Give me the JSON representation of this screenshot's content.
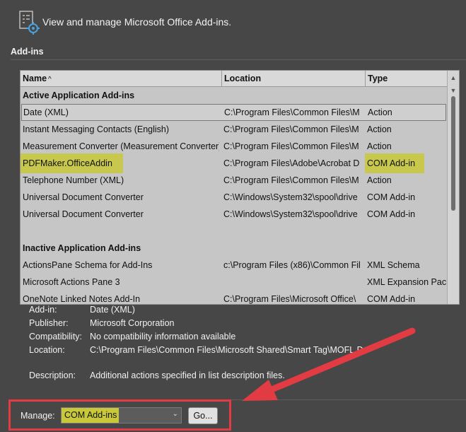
{
  "header": {
    "title": "View and manage Microsoft Office Add-ins.",
    "icon": "addins-gear-icon"
  },
  "section_title": "Add-ins",
  "columns": {
    "name": "Name",
    "sort_indicator": "^",
    "location": "Location",
    "type": "Type"
  },
  "groups": {
    "active": "Active Application Add-ins",
    "inactive": "Inactive Application Add-ins"
  },
  "active_rows": [
    {
      "name": "Date (XML)",
      "location": "C:\\Program Files\\Common Files\\M",
      "type": "Action"
    },
    {
      "name": "Instant Messaging Contacts (English)",
      "location": "C:\\Program Files\\Common Files\\M",
      "type": "Action"
    },
    {
      "name": "Measurement Converter (Measurement Converter)",
      "location": "C:\\Program Files\\Common Files\\M",
      "type": "Action"
    },
    {
      "name": "PDFMaker.OfficeAddin",
      "location": "C:\\Program Files\\Adobe\\Acrobat D",
      "type": "COM Add-in"
    },
    {
      "name": "Telephone Number (XML)",
      "location": "C:\\Program Files\\Common Files\\M",
      "type": "Action"
    },
    {
      "name": "Universal Document Converter",
      "location": "C:\\Windows\\System32\\spool\\drive",
      "type": "COM Add-in"
    },
    {
      "name": "Universal Document Converter",
      "location": "C:\\Windows\\System32\\spool\\drive",
      "type": "COM Add-in"
    }
  ],
  "inactive_rows": [
    {
      "name": "ActionsPane Schema for Add-Ins",
      "location": "c:\\Program Files (x86)\\Common Fil",
      "type": "XML Schema"
    },
    {
      "name": "Microsoft Actions Pane 3",
      "location": "",
      "type": "XML Expansion Pack"
    },
    {
      "name": "OneNote Linked Notes Add-In",
      "location": "C:\\Program Files\\Microsoft Office\\",
      "type": "COM Add-in"
    }
  ],
  "details": {
    "addin_label": "Add-in:",
    "addin_value": "Date (XML)",
    "publisher_label": "Publisher:",
    "publisher_value": "Microsoft Corporation",
    "compat_label": "Compatibility:",
    "compat_value": "No compatibility information available",
    "location_label": "Location:",
    "location_value": "C:\\Program Files\\Common Files\\Microsoft Shared\\Smart Tag\\MOFL.DLL",
    "description_label": "Description:",
    "description_value": "Additional actions specified in list description files."
  },
  "manage": {
    "label": "Manage:",
    "selected": "COM Add-ins",
    "go_label": "Go..."
  },
  "colors": {
    "highlight": "#c8c83a",
    "annotation_red": "#e23b44"
  }
}
